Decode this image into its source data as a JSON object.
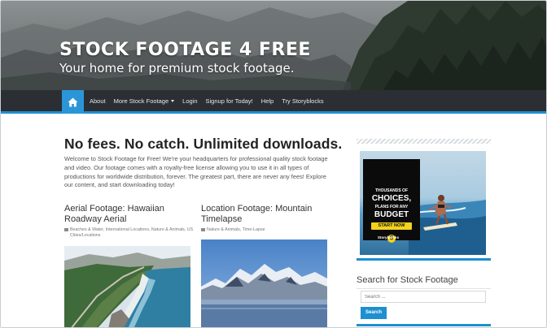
{
  "header": {
    "site_title": "STOCK FOOTAGE 4 FREE",
    "tagline": "Your home for premium stock footage."
  },
  "nav": {
    "items": [
      {
        "label": "About"
      },
      {
        "label": "More Stock Footage",
        "has_dropdown": true
      },
      {
        "label": "Login"
      },
      {
        "label": "Signup for Today!"
      },
      {
        "label": "Help"
      },
      {
        "label": "Try Storyblocks"
      }
    ],
    "home_icon": "home-icon"
  },
  "main": {
    "headline": "No fees. No catch. Unlimited downloads.",
    "intro": "Welcome to Stock Footage for Free! We're your headquarters for professional quality stock footage and video. Our footage comes with a royalty-free license allowing you to use it in all types of productions for worldwide distribution, forever. The greatest part, there are never any fees! Explore our content, and start downloading today!",
    "posts": [
      {
        "title": "Aerial Footage: Hawaiian Roadway Aerial",
        "meta": "Beaches & Water, International Locations, Nature & Animals, US Cities/Locations"
      },
      {
        "title": "Location Footage: Mountain Timelapse",
        "meta": "Nature & Animals, Time-Lapse"
      }
    ]
  },
  "sidebar": {
    "ad": {
      "line1": "THOUSANDS OF",
      "line2": "CHOICES,",
      "line3": "PLANS FOR ANY",
      "line4": "BUDGET",
      "button": "START NOW",
      "brand": "Storyblocks",
      "logo_letter": "S"
    },
    "search": {
      "title": "Search for Stock Footage",
      "placeholder": "Search ...",
      "button": "Search"
    }
  },
  "colors": {
    "accent": "#1e8fd1",
    "nav_bg": "#2b2f33",
    "ad_button": "#f3d11c"
  }
}
